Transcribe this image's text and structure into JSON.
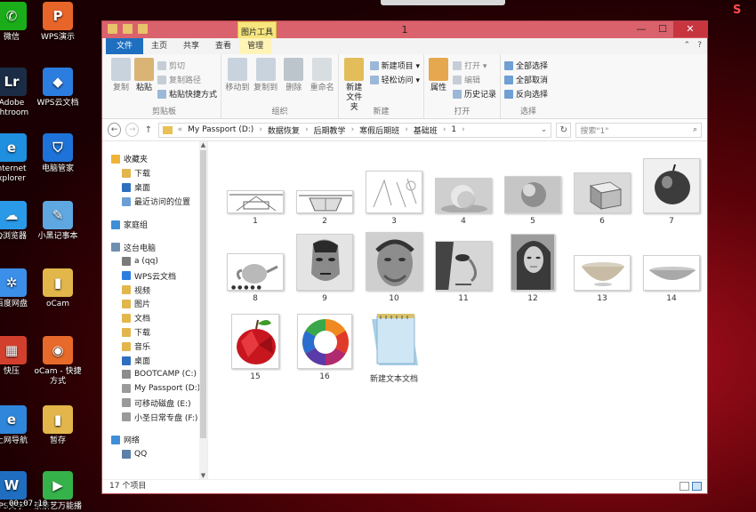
{
  "desktop": {
    "icons": [
      {
        "label": "微信",
        "name": "wechat",
        "color": "#1aad19",
        "glyph": "✆"
      },
      {
        "label": "WPS演示",
        "name": "wps-presentation",
        "color": "#e8652a",
        "glyph": "P"
      },
      {
        "label": "Adobe\nghtroom",
        "name": "adobe-lightroom",
        "color": "#1b2d46",
        "glyph": "Lr"
      },
      {
        "label": "WPS云文档",
        "name": "wps-cloud-docs",
        "color": "#2b7de0",
        "glyph": "◆"
      },
      {
        "label": "nternet\nxplorer",
        "name": "internet-explorer",
        "color": "#1f8fe0",
        "glyph": "e"
      },
      {
        "label": "电脑管家",
        "name": "pc-manager",
        "color": "#1d73d8",
        "glyph": "⛉"
      },
      {
        "label": "Q浏览器",
        "name": "qq-browser",
        "color": "#2a9ae8",
        "glyph": "☁"
      },
      {
        "label": "小黑记事本",
        "name": "notepad-app",
        "color": "#5fa7e0",
        "glyph": "✎"
      },
      {
        "label": "百度网盘",
        "name": "baidu-netdisk",
        "color": "#3b8fe8",
        "glyph": "✲"
      },
      {
        "label": "oCam",
        "name": "ocam-folder",
        "color": "#e3b64c",
        "glyph": "▮"
      },
      {
        "label": "快压",
        "name": "kuaiya",
        "color": "#d2402d",
        "glyph": "▦"
      },
      {
        "label": "oCam - 快捷\n方式",
        "name": "ocam-shortcut",
        "color": "#e76a2a",
        "glyph": "◉"
      },
      {
        "label": "上网导航",
        "name": "web-navigation",
        "color": "#2f86db",
        "glyph": "e"
      },
      {
        "label": "暂存",
        "name": "temp-folder",
        "color": "#e3b64c",
        "glyph": "▮"
      },
      {
        "label": "PS文字",
        "name": "ps-text",
        "color": "#1f6ec0",
        "glyph": "W"
      },
      {
        "label": "奈奈艺万能播",
        "name": "video-player",
        "color": "#35b34a",
        "glyph": "▶"
      }
    ],
    "clock": "00:07:10",
    "ime_logo": "S"
  },
  "window": {
    "title": "1",
    "context_tab": "图片工具",
    "controls": {
      "minimize": "—",
      "maximize": "☐",
      "close": "✕"
    },
    "tabs": [
      "文件",
      "主页",
      "共享",
      "查看",
      "管理"
    ],
    "ribbon_right": [
      "⌃",
      "?"
    ],
    "ribbon": {
      "clipboard": {
        "copy": "复制",
        "paste": "粘贴",
        "cut": "剪切",
        "copy_path": "复制路径",
        "paste_shortcut": "粘贴快捷方式",
        "label": "剪贴板"
      },
      "organize": {
        "move_to": "移动到",
        "copy_to": "复制到",
        "delete": "删除",
        "rename": "重命名",
        "label": "组织"
      },
      "new": {
        "new_folder": "新建\n文件夹",
        "new_item": "新建项目 ▾",
        "easy_access": "轻松访问 ▾",
        "label": "新建"
      },
      "open": {
        "properties": "属性",
        "open": "打开 ▾",
        "edit": "编辑",
        "history": "历史记录",
        "label": "打开"
      },
      "select": {
        "select_all": "全部选择",
        "select_none": "全部取消",
        "invert": "反向选择",
        "label": "选择"
      }
    },
    "address": {
      "back": "←",
      "forward": "→",
      "up": "↑",
      "breadcrumb": [
        "My Passport (D:)",
        "数据恢复",
        "后期教学",
        "寒假后期班",
        "基础班",
        "1"
      ],
      "prefix": "«",
      "separator": "›",
      "refresh": "↻",
      "search_placeholder": "搜索\"1\""
    },
    "nav": {
      "favorites": "收藏夹",
      "fav_items": [
        "下载",
        "桌面",
        "最近访问的位置"
      ],
      "homegroup": "家庭组",
      "this_pc": "这台电脑",
      "pc_items": [
        "a (qq)",
        "WPS云文档",
        "视频",
        "图片",
        "文档",
        "下载",
        "音乐",
        "桌面",
        "BOOTCAMP (C:)",
        "My Passport (D:)",
        "可移动磁盘 (E:)",
        "小圣日常专盘 (F:)"
      ],
      "network": "网络",
      "network_items": [
        "QQ"
      ]
    },
    "files": [
      {
        "name": "1",
        "kind": "perspective1"
      },
      {
        "name": "2",
        "kind": "perspective2"
      },
      {
        "name": "3",
        "kind": "sketch"
      },
      {
        "name": "4",
        "kind": "sphere"
      },
      {
        "name": "5",
        "kind": "sphere2"
      },
      {
        "name": "6",
        "kind": "cube"
      },
      {
        "name": "7",
        "kind": "apple"
      },
      {
        "name": "8",
        "kind": "teapot"
      },
      {
        "name": "9",
        "kind": "face1"
      },
      {
        "name": "10",
        "kind": "face2"
      },
      {
        "name": "11",
        "kind": "face3"
      },
      {
        "name": "12",
        "kind": "face4"
      },
      {
        "name": "13",
        "kind": "bowl"
      },
      {
        "name": "14",
        "kind": "bowl2"
      },
      {
        "name": "15",
        "kind": "redapple"
      },
      {
        "name": "16",
        "kind": "colorwheel"
      },
      {
        "name": "新建文本文档",
        "kind": "textfile"
      }
    ],
    "status": "17 个项目"
  }
}
